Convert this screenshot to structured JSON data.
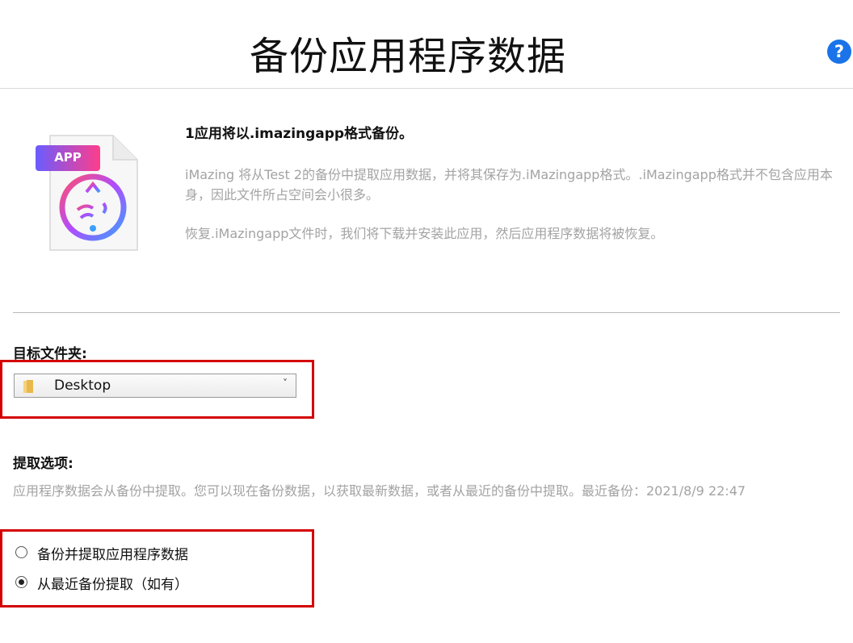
{
  "header": {
    "title": "备份应用程序数据",
    "help_label": "?"
  },
  "info": {
    "icon_badge": "APP",
    "heading": "1应用将以.imazingapp格式备份。",
    "paragraph1": "iMazing 将从Test 2的备份中提取应用数据，并将其保存为.iMazingapp格式。.iMazingapp格式并不包含应用本身，因此文件所占空间会小很多。",
    "paragraph2": "恢复.iMazingapp文件时，我们将下载并安装此应用，然后应用程序数据将被恢复。"
  },
  "destination": {
    "label": "目标文件夹:",
    "selected": "Desktop",
    "chevron": "˅"
  },
  "extraction": {
    "label": "提取选项:",
    "description": "应用程序数据会从备份中提取。您可以现在备份数据，以获取最新数据，或者从最近的备份中提取。最近备份：2021/8/9 22:47",
    "options": [
      {
        "label": "备份并提取应用程序数据",
        "selected": false
      },
      {
        "label": "从最近备份提取（如有）",
        "selected": true
      }
    ]
  },
  "colors": {
    "accent": "#1a73e8",
    "highlight": "#d40000",
    "muted_text": "#a3a3a3"
  }
}
